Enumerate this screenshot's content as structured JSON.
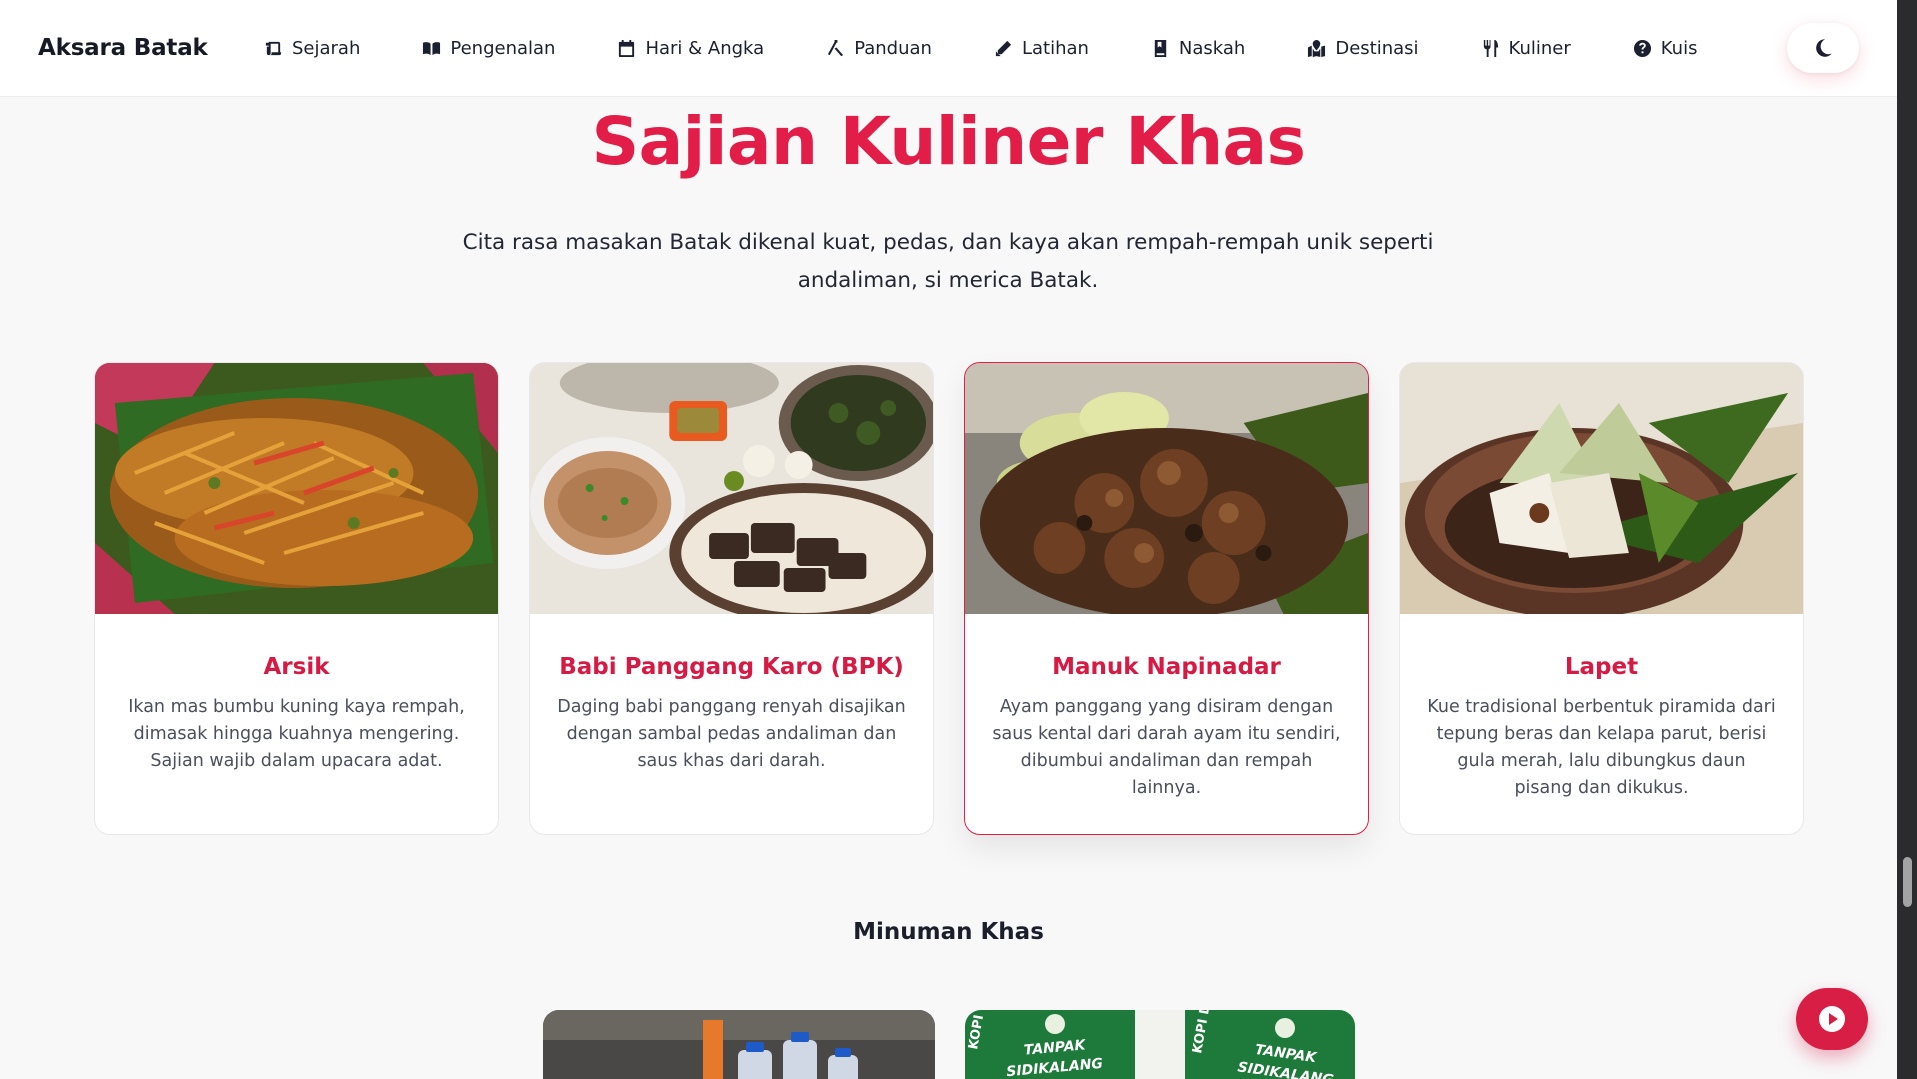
{
  "navbar": {
    "brand": "Aksara Batak",
    "items": [
      {
        "label": "Sejarah",
        "icon": "scroll-icon"
      },
      {
        "label": "Pengenalan",
        "icon": "book-open-icon"
      },
      {
        "label": "Hari & Angka",
        "icon": "calendar-icon"
      },
      {
        "label": "Panduan",
        "icon": "compass-drafting-icon"
      },
      {
        "label": "Latihan",
        "icon": "pencil-icon"
      },
      {
        "label": "Naskah",
        "icon": "book-bookmark-icon"
      },
      {
        "label": "Destinasi",
        "icon": "map-location-icon"
      },
      {
        "label": "Kuliner",
        "icon": "utensils-icon"
      },
      {
        "label": "Kuis",
        "icon": "question-circle-icon"
      }
    ],
    "theme_toggle_icon": "moon-icon"
  },
  "section": {
    "title": "Sajian Kuliner Khas",
    "description": "Cita rasa masakan Batak dikenal kuat, pedas, dan kaya akan rempah-rempah unik seperti andaliman, si merica Batak."
  },
  "dishes": [
    {
      "title": "Arsik",
      "description": "Ikan mas bumbu kuning kaya rempah, dimasak hingga kuahnya mengering. Sajian wajib dalam upacara adat."
    },
    {
      "title": "Babi Panggang Karo (BPK)",
      "description": "Daging babi panggang renyah disajikan dengan sambal pedas andaliman dan saus khas dari darah."
    },
    {
      "title": "Manuk Napinadar",
      "description": "Ayam panggang yang disiram dengan saus kental dari darah ayam itu sendiri, dibumbui andaliman dan rempah lainnya."
    },
    {
      "title": "Lapet",
      "description": "Kue tradisional berbentuk piramida dari tepung beras dan kelapa parut, berisi gula merah, lalu dibungkus daun pisang dan dikukus."
    }
  ],
  "drinks": {
    "title": "Minuman Khas",
    "image_text": {
      "brand_line_1": "TANPAK",
      "brand_line_2": "SIDIKALANG",
      "side_text": "KOPI DJA"
    }
  },
  "floating": {
    "play_icon": "play-icon"
  },
  "colors": {
    "accent": "#e11d48",
    "card_title": "#d61a43",
    "text_dark": "#1f2430",
    "text_muted": "#4a4f5c",
    "background": "#f8f8f9"
  }
}
